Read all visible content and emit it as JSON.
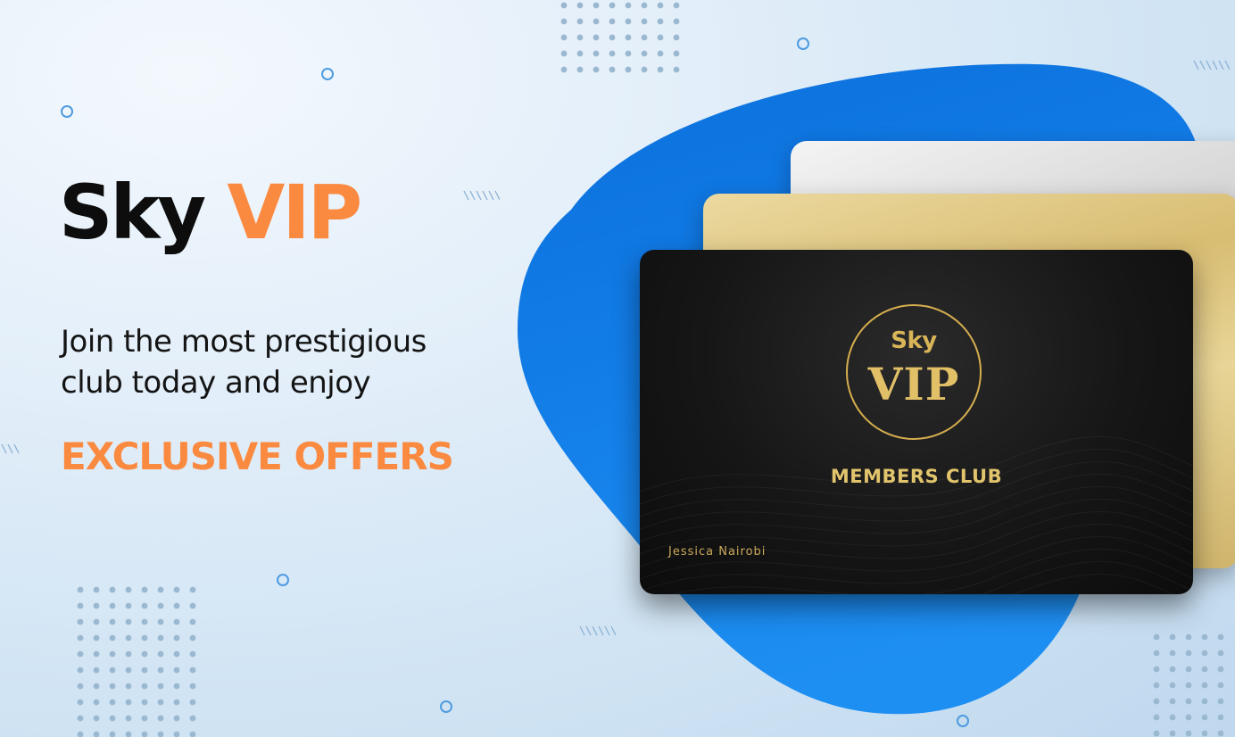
{
  "headline": {
    "word1": "Sky",
    "word2": "VIP"
  },
  "tagline": {
    "line1": "Join the most prestigious",
    "line2": "club today and enjoy"
  },
  "offer": "EXCLUSIVE OFFERS",
  "card": {
    "emblem_top": "Sky",
    "emblem_main": "VIP",
    "club_name": "MEMBERS CLUB",
    "holder_name": "Jessica Nairobi"
  },
  "colors": {
    "accent_orange": "#fb8a41",
    "blob_blue": "#1677e0",
    "gold": "#d9b558",
    "card_black": "#161616"
  }
}
